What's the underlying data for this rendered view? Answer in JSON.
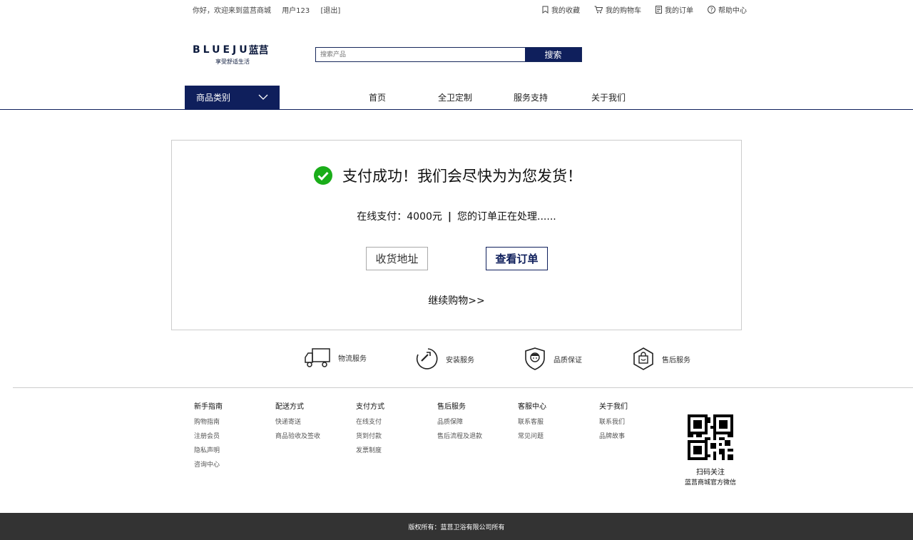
{
  "topbar": {
    "welcome": "你好，欢迎来到蓝莒商城",
    "user": "用户123",
    "logout": "[退出]",
    "links": [
      {
        "label": "我的收藏",
        "icon": "bookmark-icon"
      },
      {
        "label": "我的购物车",
        "icon": "cart-icon"
      },
      {
        "label": "我的订单",
        "icon": "order-icon"
      },
      {
        "label": "帮助中心",
        "icon": "help-icon"
      }
    ]
  },
  "logo": {
    "brand": "BLUEJU",
    "brand_cn": "蓝莒",
    "slogan": "享受舒适生活"
  },
  "search": {
    "placeholder": "搜索产品",
    "button": "搜索"
  },
  "nav": {
    "category": "商品类别",
    "items": [
      "首页",
      "全卫定制",
      "服务支持",
      "关于我们"
    ]
  },
  "success": {
    "title": "支付成功！我们会尽快为为您发货！",
    "pay_label": "在线支付：4000元",
    "separator": "|",
    "status": "您的订单正在处理......",
    "address_button": "收货地址",
    "order_button": "查看订单",
    "continue": "继续购物>>"
  },
  "services": [
    {
      "label": "物流服务",
      "icon": "truck-icon"
    },
    {
      "label": "安装服务",
      "icon": "wrench-icon"
    },
    {
      "label": "品质保证",
      "icon": "shield-icon"
    },
    {
      "label": "售后服务",
      "icon": "bag-icon"
    }
  ],
  "footer": {
    "columns": [
      {
        "title": "新手指南",
        "items": [
          "购物指南",
          "注册会员",
          "隐私声明",
          "咨询中心"
        ]
      },
      {
        "title": "配送方式",
        "items": [
          "快递寄送",
          "商品验收及签收"
        ]
      },
      {
        "title": "支付方式",
        "items": [
          "在线支付",
          "货到付款",
          "发票制度"
        ]
      },
      {
        "title": "售后服务",
        "items": [
          "品质保障",
          "售后流程及退款"
        ]
      },
      {
        "title": "客服中心",
        "items": [
          "联系客服",
          "常见问题"
        ]
      },
      {
        "title": "关于我们",
        "items": [
          "联系我们",
          "品牌故事"
        ]
      }
    ],
    "qr_title": "扫码关注",
    "qr_sub": "蓝莒商城官方微信",
    "copyright": "版权所有：蓝莒卫浴有限公司所有"
  },
  "colors": {
    "brand": "#0f1f5c",
    "success": "#1aad19"
  }
}
